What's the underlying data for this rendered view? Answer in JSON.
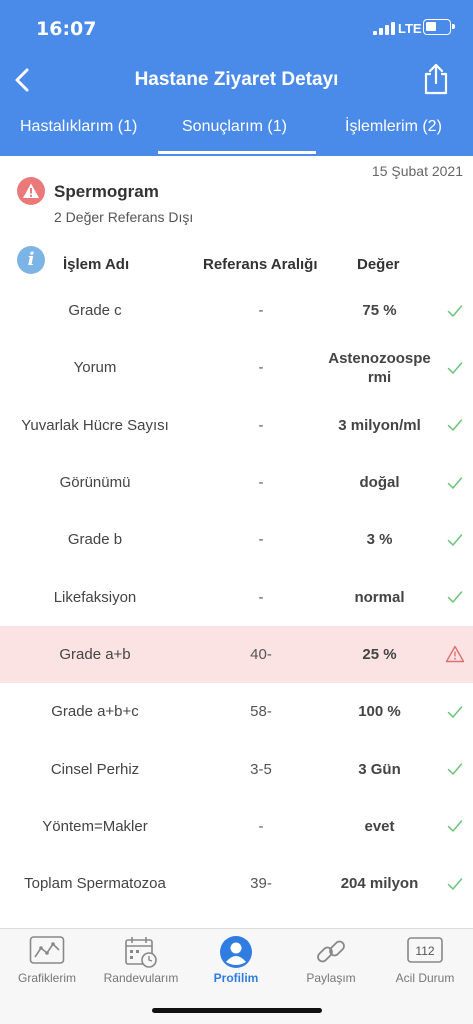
{
  "status_bar": {
    "time": "16:07",
    "network": "LTE"
  },
  "header": {
    "title": "Hastane Ziyaret Detayı"
  },
  "tabs": [
    {
      "label": "Hastalıklarım (1)"
    },
    {
      "label": "Sonuçlarım (1)"
    },
    {
      "label": "İşlemlerim (2)"
    }
  ],
  "result": {
    "date": "15 Şubat 2021",
    "title": "Spermogram",
    "subtitle": "2 Değer Referans Dışı"
  },
  "table": {
    "headers": {
      "name": "İşlem Adı",
      "ref": "Referans Aralığı",
      "value": "Değer"
    },
    "rows": [
      {
        "name": "Grade c",
        "ref": "-",
        "value": "75 %",
        "status": "ok"
      },
      {
        "name": "Yorum",
        "ref": "-",
        "value": "Astenozoospe rmi",
        "status": "ok"
      },
      {
        "name": "Yuvarlak Hücre Sayısı",
        "ref": "-",
        "value": "3 milyon/ml",
        "status": "ok"
      },
      {
        "name": "Görünümü",
        "ref": "-",
        "value": "doğal",
        "status": "ok"
      },
      {
        "name": "Grade b",
        "ref": "-",
        "value": "3 %",
        "status": "ok"
      },
      {
        "name": "Likefaksiyon",
        "ref": "-",
        "value": "normal",
        "status": "ok"
      },
      {
        "name": "Grade a+b",
        "ref": "40-",
        "value": "25 %",
        "status": "warning"
      },
      {
        "name": "Grade a+b+c",
        "ref": "58-",
        "value": "100 %",
        "status": "ok"
      },
      {
        "name": "Cinsel Perhiz",
        "ref": "3-5",
        "value": "3 Gün",
        "status": "ok"
      },
      {
        "name": "Yöntem=Makler",
        "ref": "-",
        "value": "evet",
        "status": "ok"
      },
      {
        "name": "Toplam Spermatozoa",
        "ref": "39-",
        "value": "204 milyon",
        "status": "ok"
      }
    ]
  },
  "bottom_nav": [
    {
      "label": "Grafiklerim",
      "icon": "chart-icon"
    },
    {
      "label": "Randevularım",
      "icon": "calendar-icon"
    },
    {
      "label": "Profilim",
      "icon": "profile-icon",
      "active": true
    },
    {
      "label": "Paylaşım",
      "icon": "link-icon"
    },
    {
      "label": "Acil Durum",
      "icon": "emergency-icon",
      "badge": "112"
    }
  ],
  "colors": {
    "header": "#4a8bea",
    "ok": "#6cc47a",
    "warning": "#e07070",
    "active": "#2f7de0"
  }
}
